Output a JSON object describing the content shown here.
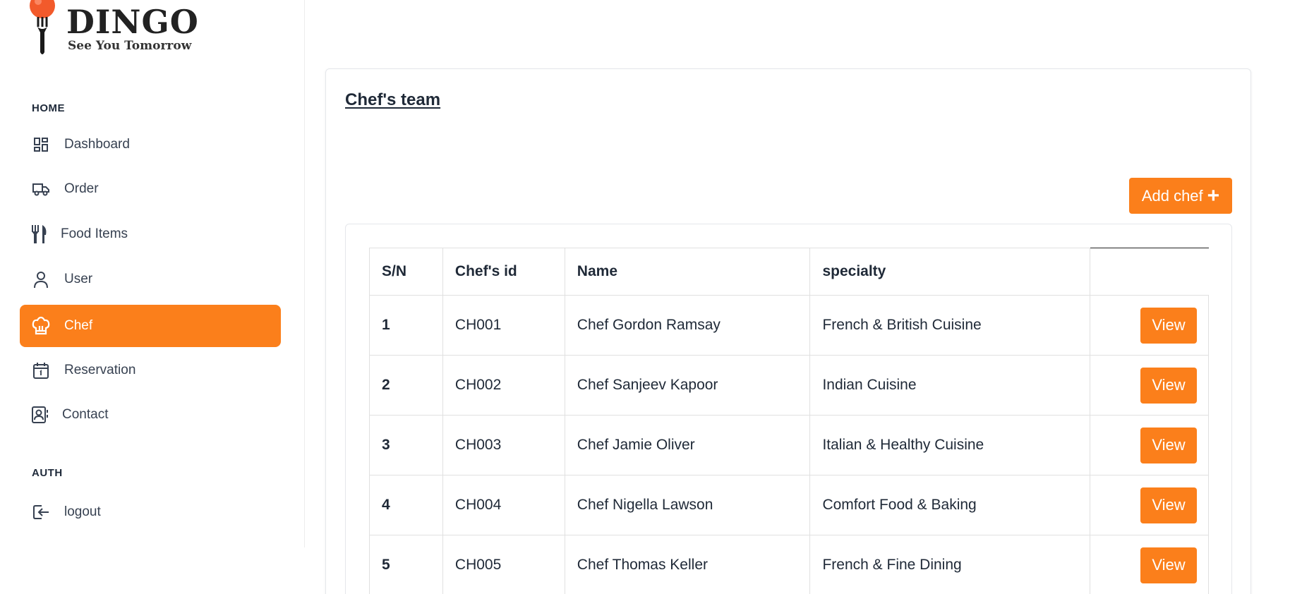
{
  "brand": {
    "name": "DINGO",
    "tagline": "See You Tomorrow"
  },
  "sidebar": {
    "home_label": "HOME",
    "auth_label": "AUTH",
    "items": [
      {
        "label": "Dashboard",
        "icon": "dashboard-icon"
      },
      {
        "label": "Order",
        "icon": "truck-icon"
      },
      {
        "label": "Food Items",
        "icon": "fork-knife-icon"
      },
      {
        "label": "User",
        "icon": "user-icon"
      },
      {
        "label": "Chef",
        "icon": "chef-hat-icon",
        "active": true
      },
      {
        "label": "Reservation",
        "icon": "calendar-icon"
      },
      {
        "label": "Contact",
        "icon": "contact-card-icon"
      }
    ],
    "logout": {
      "label": "logout",
      "icon": "logout-icon"
    }
  },
  "main": {
    "title": "Chef's team",
    "add_button": "Add chef",
    "table": {
      "headers": [
        "S/N",
        "Chef's id",
        "Name",
        "specialty",
        ""
      ],
      "view_label": "View",
      "rows": [
        {
          "sn": "1",
          "id": "CH001",
          "name": "Chef Gordon Ramsay",
          "specialty": "French & British Cuisine"
        },
        {
          "sn": "2",
          "id": "CH002",
          "name": "Chef Sanjeev Kapoor",
          "specialty": "Indian Cuisine"
        },
        {
          "sn": "3",
          "id": "CH003",
          "name": "Chef Jamie Oliver",
          "specialty": "Italian & Healthy Cuisine"
        },
        {
          "sn": "4",
          "id": "CH004",
          "name": "Chef Nigella Lawson",
          "specialty": "Comfort Food & Baking"
        },
        {
          "sn": "5",
          "id": "CH005",
          "name": "Chef Thomas Keller",
          "specialty": "French & Fine Dining"
        }
      ]
    }
  },
  "colors": {
    "accent": "#fb7f1b",
    "text": "#1f2937"
  }
}
